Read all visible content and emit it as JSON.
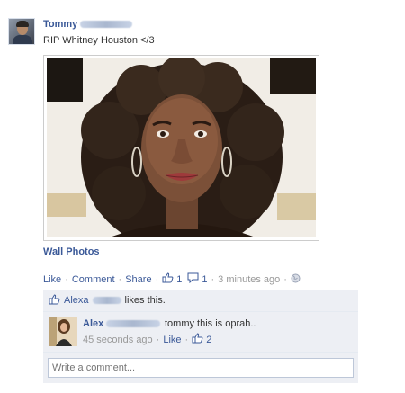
{
  "post": {
    "author": "Tommy",
    "text": "RIP Whitney Houston </3",
    "album_link": "Wall Photos",
    "actions": {
      "like": "Like",
      "comment": "Comment",
      "share": "Share",
      "like_count": "1",
      "comment_count": "1",
      "time": "3 minutes ago"
    }
  },
  "likes_row": {
    "name": "Alexa",
    "suffix": "likes this."
  },
  "comment": {
    "author": "Alex",
    "text": "tommy this is oprah..",
    "time": "45 seconds ago",
    "like_label": "Like",
    "like_count": "2"
  },
  "write_comment": {
    "placeholder": "Write a comment..."
  },
  "colors": {
    "link": "#3b5998",
    "feedback_bg": "#edeff4",
    "muted": "#999999"
  },
  "icons": [
    "thumbs-up-icon",
    "comment-bubble-icon",
    "globe-icon"
  ]
}
